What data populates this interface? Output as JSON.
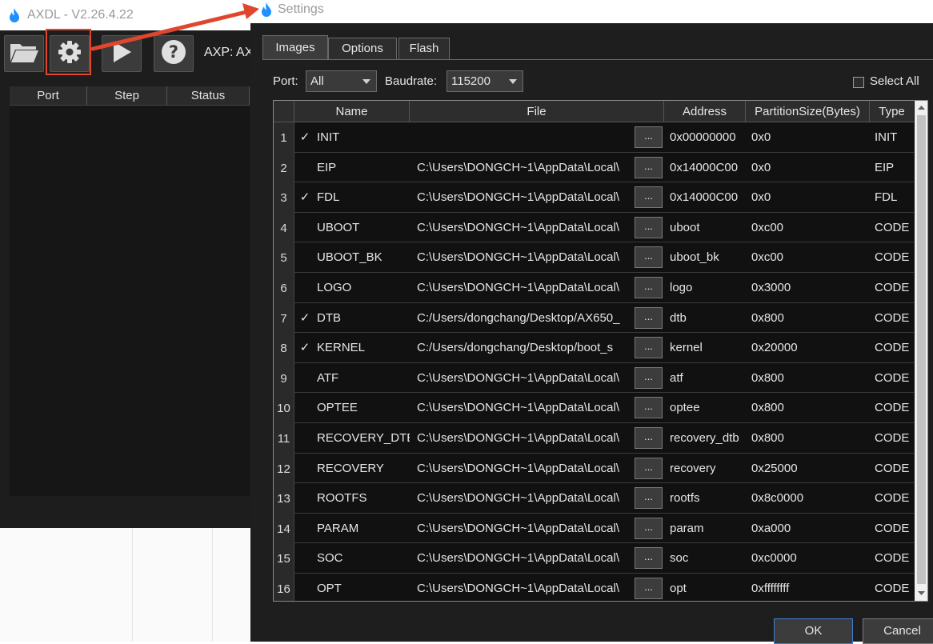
{
  "axdl": {
    "title": "AXDL - V2.26.4.22",
    "toolbar": {
      "open_icon": "folder-open-icon",
      "settings_icon": "gear-icon",
      "start_icon": "play-icon",
      "help_icon": "help-icon",
      "axp_label": "AXP: AX"
    },
    "port_table": {
      "columns": [
        "Port",
        "Step",
        "Status"
      ]
    }
  },
  "settings": {
    "title": "Settings",
    "tabs": [
      {
        "label": "Images",
        "active": true
      },
      {
        "label": "Options",
        "active": false
      },
      {
        "label": "Flash",
        "active": false
      }
    ],
    "port_label": "Port:",
    "port_value": "All",
    "baudrate_label": "Baudrate:",
    "baudrate_value": "115200",
    "select_all_label": "Select All",
    "columns": [
      "Name",
      "File",
      "Address",
      "PartitionSize(Bytes)",
      "Type"
    ],
    "browse_label": "...",
    "rows": [
      {
        "num": "1",
        "checked": true,
        "name": "INIT",
        "file": "",
        "address": "0x00000000",
        "size": "0x0",
        "type": "INIT"
      },
      {
        "num": "2",
        "checked": false,
        "name": "EIP",
        "file": "C:\\Users\\DONGCH~1\\AppData\\Local\\",
        "address": "0x14000C00",
        "size": "0x0",
        "type": "EIP"
      },
      {
        "num": "3",
        "checked": true,
        "name": "FDL",
        "file": "C:\\Users\\DONGCH~1\\AppData\\Local\\",
        "address": "0x14000C00",
        "size": "0x0",
        "type": "FDL"
      },
      {
        "num": "4",
        "checked": false,
        "name": "UBOOT",
        "file": "C:\\Users\\DONGCH~1\\AppData\\Local\\",
        "address": "uboot",
        "size": "0xc00",
        "type": "CODE"
      },
      {
        "num": "5",
        "checked": false,
        "name": "UBOOT_BK",
        "file": "C:\\Users\\DONGCH~1\\AppData\\Local\\",
        "address": "uboot_bk",
        "size": "0xc00",
        "type": "CODE"
      },
      {
        "num": "6",
        "checked": false,
        "name": "LOGO",
        "file": "C:\\Users\\DONGCH~1\\AppData\\Local\\",
        "address": "logo",
        "size": "0x3000",
        "type": "CODE"
      },
      {
        "num": "7",
        "checked": true,
        "name": "DTB",
        "file": "C:/Users/dongchang/Desktop/AX650_",
        "address": "dtb",
        "size": "0x800",
        "type": "CODE"
      },
      {
        "num": "8",
        "checked": true,
        "name": "KERNEL",
        "file": "C:/Users/dongchang/Desktop/boot_s",
        "address": "kernel",
        "size": "0x20000",
        "type": "CODE"
      },
      {
        "num": "9",
        "checked": false,
        "name": "ATF",
        "file": "C:\\Users\\DONGCH~1\\AppData\\Local\\",
        "address": "atf",
        "size": "0x800",
        "type": "CODE"
      },
      {
        "num": "10",
        "checked": false,
        "name": "OPTEE",
        "file": "C:\\Users\\DONGCH~1\\AppData\\Local\\",
        "address": "optee",
        "size": "0x800",
        "type": "CODE"
      },
      {
        "num": "11",
        "checked": false,
        "name": "RECOVERY_DTB",
        "file": "C:\\Users\\DONGCH~1\\AppData\\Local\\",
        "address": "recovery_dtb",
        "size": "0x800",
        "type": "CODE"
      },
      {
        "num": "12",
        "checked": false,
        "name": "RECOVERY",
        "file": "C:\\Users\\DONGCH~1\\AppData\\Local\\",
        "address": "recovery",
        "size": "0x25000",
        "type": "CODE"
      },
      {
        "num": "13",
        "checked": false,
        "name": "ROOTFS",
        "file": "C:\\Users\\DONGCH~1\\AppData\\Local\\",
        "address": "rootfs",
        "size": "0x8c0000",
        "type": "CODE"
      },
      {
        "num": "14",
        "checked": false,
        "name": "PARAM",
        "file": "C:\\Users\\DONGCH~1\\AppData\\Local\\",
        "address": "param",
        "size": "0xa000",
        "type": "CODE"
      },
      {
        "num": "15",
        "checked": false,
        "name": "SOC",
        "file": "C:\\Users\\DONGCH~1\\AppData\\Local\\",
        "address": "soc",
        "size": "0xc0000",
        "type": "CODE"
      },
      {
        "num": "16",
        "checked": false,
        "name": "OPT",
        "file": "C:\\Users\\DONGCH~1\\AppData\\Local\\",
        "address": "opt",
        "size": "0xffffffff",
        "type": "CODE"
      }
    ],
    "ok_label": "OK",
    "cancel_label": "Cancel"
  },
  "colors": {
    "accent_flame": "#1e90ff",
    "annotation_red": "#e0462e"
  }
}
